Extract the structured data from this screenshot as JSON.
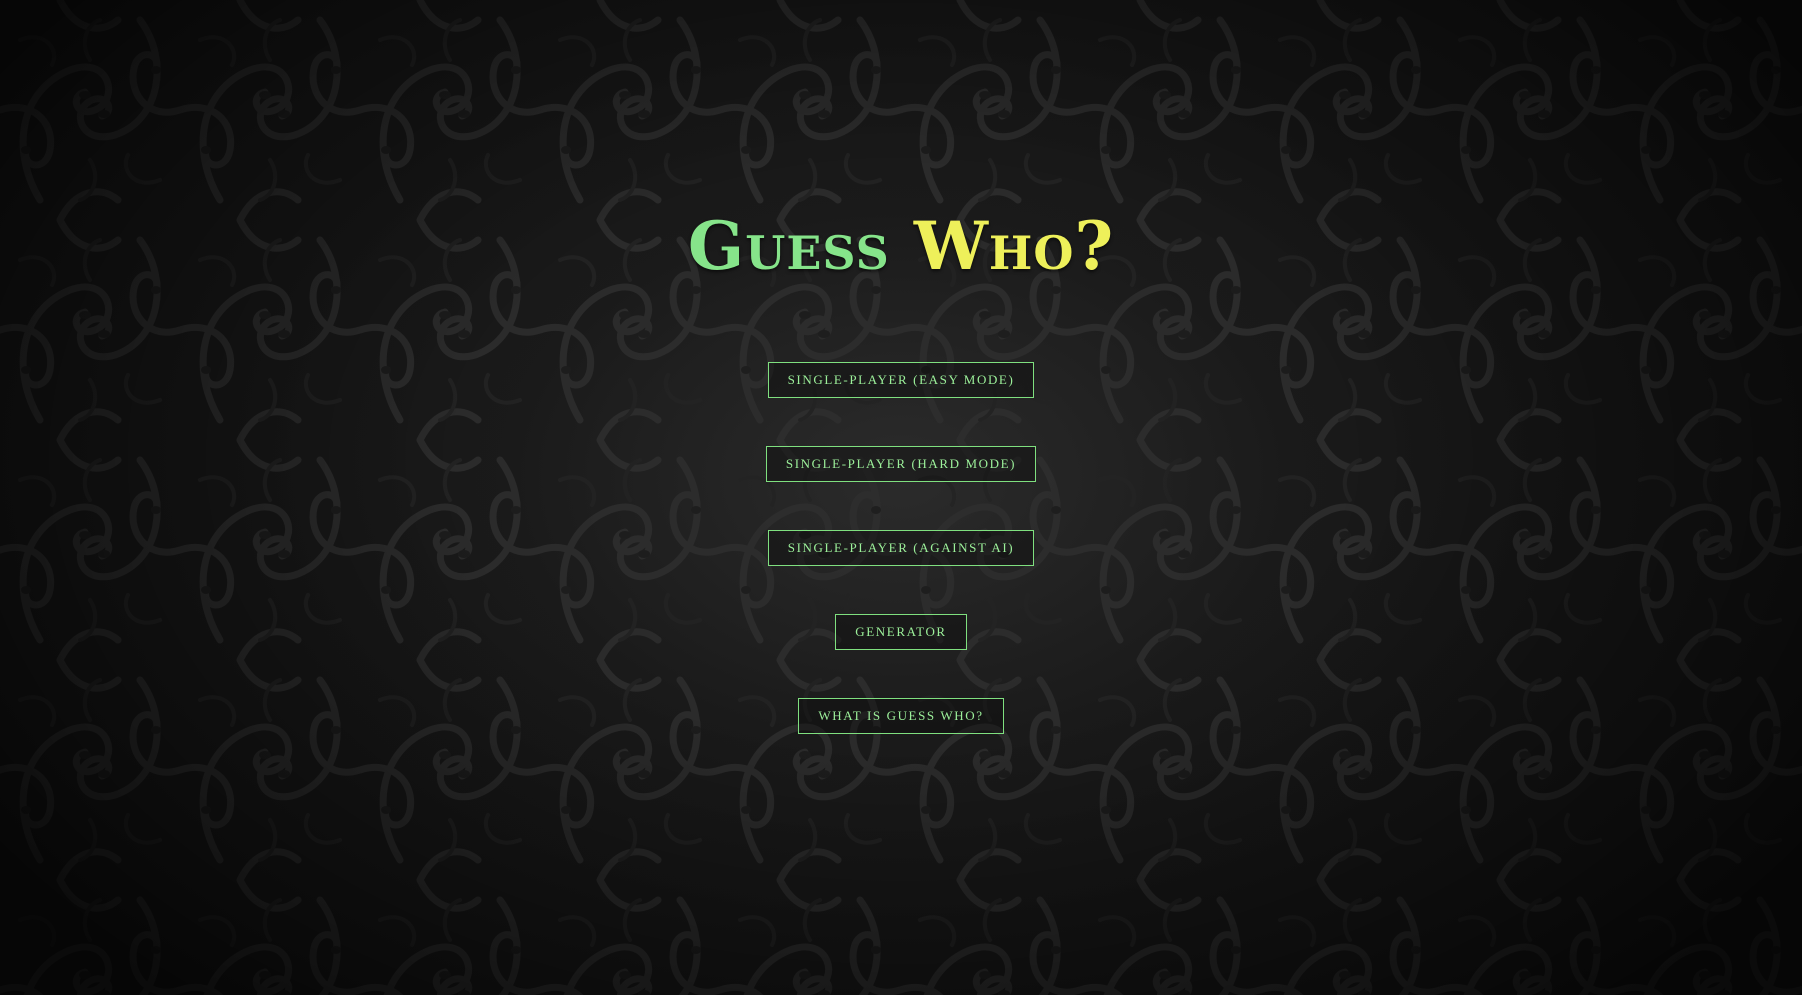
{
  "title": {
    "word1": "Guess",
    "word2": "Who?"
  },
  "menu": {
    "items": [
      {
        "label": "Single-player (Easy mode)"
      },
      {
        "label": "Single-player (Hard mode)"
      },
      {
        "label": "Single-player (Against AI)"
      },
      {
        "label": "Generator"
      },
      {
        "label": "What is Guess Who?"
      }
    ]
  },
  "colors": {
    "title_green": "#86e48a",
    "title_yellow": "#eef05a",
    "button_border": "#7fe07f",
    "button_text": "#9cf09a",
    "background": "#171717"
  }
}
